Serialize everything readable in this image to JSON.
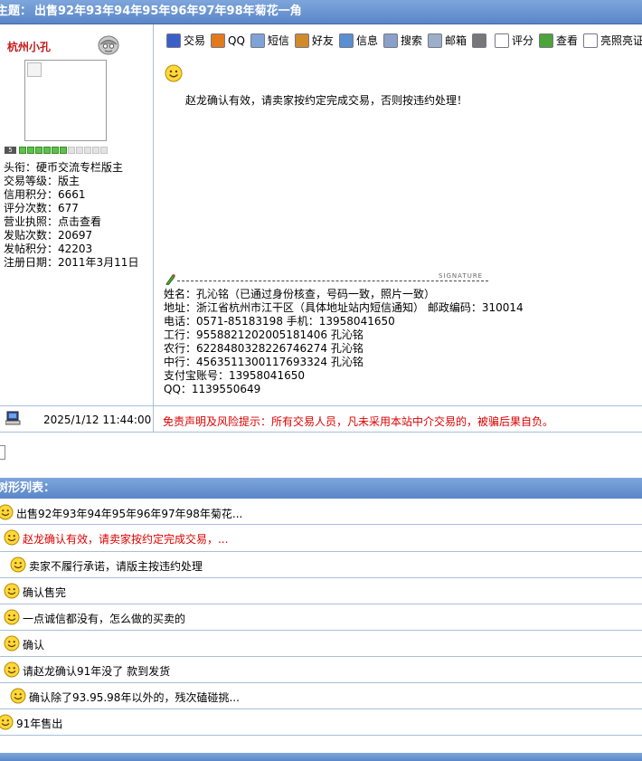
{
  "title": {
    "prefix": "主题：",
    "text": "出售92年93年94年95年96年97年98年菊花一角"
  },
  "user": {
    "name": "杭州小孔",
    "level_badge": "5",
    "level": {
      "filled": 6,
      "total": 11
    },
    "stats": [
      "头衔：硬币交流专栏版主",
      "交易等级：版主",
      "信用积分：6661",
      "评分次数：677",
      "营业执照：点击查看",
      "发贴次数：20697",
      "发帖积分：42203",
      "注册日期：2011年3月11日"
    ]
  },
  "toolbar": {
    "items": [
      {
        "label": "交易",
        "icon": "trade-icon",
        "color": "#3a5fc8"
      },
      {
        "label": "QQ",
        "icon": "qq-icon",
        "color": "#e27a1c"
      },
      {
        "label": "短信",
        "icon": "message-icon",
        "color": "#7fa3d6"
      },
      {
        "label": "好友",
        "icon": "friends-icon",
        "color": "#d08a2a"
      },
      {
        "label": "信息",
        "icon": "info-icon",
        "color": "#5a8fd0"
      },
      {
        "label": "搜索",
        "icon": "search-icon",
        "color": "#8aa0c8"
      },
      {
        "label": "邮箱",
        "icon": "mail-icon",
        "color": "#9bb0c8"
      },
      {
        "label": "",
        "icon": "note-icon",
        "color": "#777777"
      },
      {
        "label": "评分",
        "icon": "rate-icon",
        "color": "#ffffff"
      },
      {
        "label": "查看",
        "icon": "view-icon",
        "color": "#4da43a"
      },
      {
        "label": "亮照亮证",
        "icon": "license-icon",
        "color": "#ffffff"
      }
    ]
  },
  "post": {
    "message": "赵龙确认有效，请卖家按约定完成交易，否则按违约处理！",
    "signature_label": "SIGNATURE",
    "signature": [
      "姓名：孔沁铭（已通过身份核查，号码一致，照片一致）",
      "地址：浙江省杭州市江干区（具体地址站内短信通知）  邮政编码：310014",
      "电话：0571-85183198 手机：13958041650",
      "工行：9558821202005181406 孔沁铭",
      "农行：6228480328226746274 孔沁铭",
      "中行：4563511300117693324 孔沁铭",
      "支付宝账号：13958041650",
      "QQ：1139550649"
    ],
    "date": "2025/1/12 11:44:00",
    "disclaimer": "免责声明及风险提示：所有交易人员，凡未采用本站中介交易的，被骗后果自负。"
  },
  "thread": {
    "header": "树形列表：",
    "items": [
      {
        "text": "出售92年93年94年95年96年97年98年菊花...",
        "red": false,
        "indent": 0
      },
      {
        "text": "赵龙确认有效，请卖家按约定完成交易，...",
        "red": true,
        "indent": 1
      },
      {
        "text": "卖家不履行承诺，请版主按违约处理",
        "red": false,
        "indent": 2
      },
      {
        "text": "确认售完",
        "red": false,
        "indent": 1
      },
      {
        "text": "一点诚信都没有，怎么做的买卖的",
        "red": false,
        "indent": 1
      },
      {
        "text": "确认",
        "red": false,
        "indent": 1
      },
      {
        "text": "请赵龙确认91年没了  款到发货",
        "red": false,
        "indent": 1
      },
      {
        "text": "确认除了93.95.98年以外的，残次磕碰挑...",
        "red": false,
        "indent": 2
      },
      {
        "text": "91年售出",
        "red": false,
        "indent": 0
      }
    ]
  }
}
